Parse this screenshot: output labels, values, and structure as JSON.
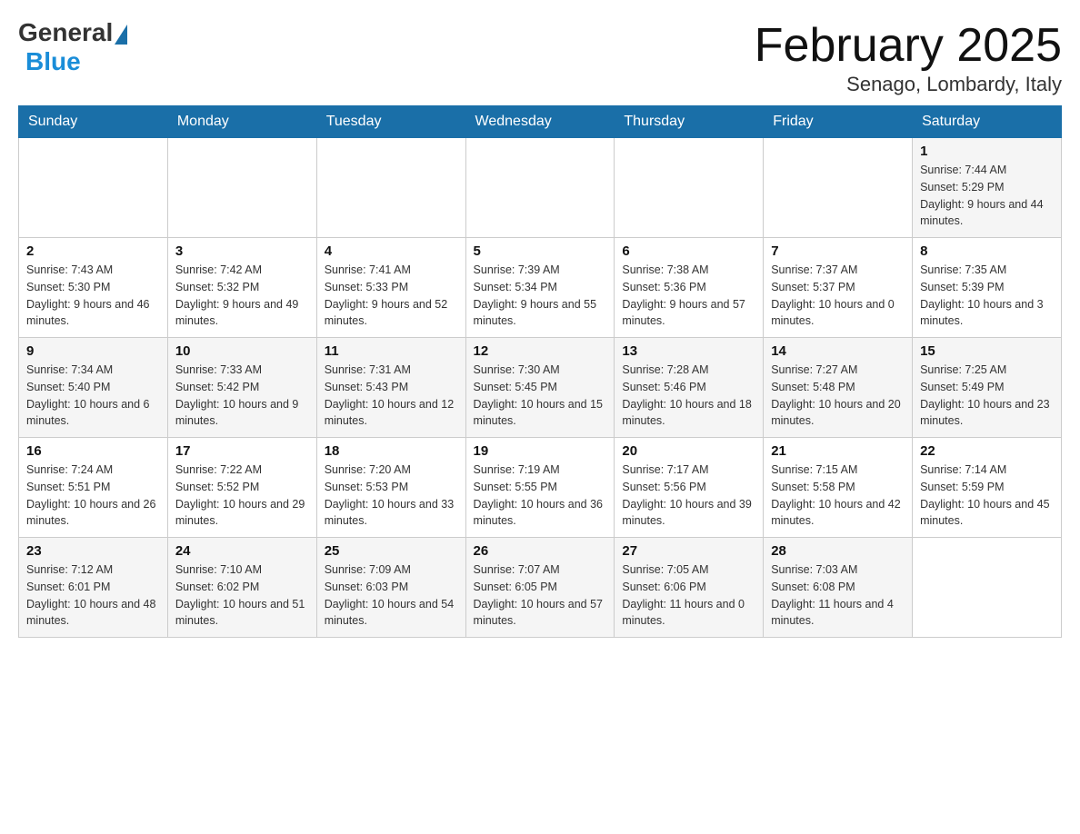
{
  "logo": {
    "general": "General",
    "blue": "Blue"
  },
  "title": "February 2025",
  "subtitle": "Senago, Lombardy, Italy",
  "days_header": [
    "Sunday",
    "Monday",
    "Tuesday",
    "Wednesday",
    "Thursday",
    "Friday",
    "Saturday"
  ],
  "weeks": [
    [
      {
        "day": "",
        "info": ""
      },
      {
        "day": "",
        "info": ""
      },
      {
        "day": "",
        "info": ""
      },
      {
        "day": "",
        "info": ""
      },
      {
        "day": "",
        "info": ""
      },
      {
        "day": "",
        "info": ""
      },
      {
        "day": "1",
        "info": "Sunrise: 7:44 AM\nSunset: 5:29 PM\nDaylight: 9 hours and 44 minutes."
      }
    ],
    [
      {
        "day": "2",
        "info": "Sunrise: 7:43 AM\nSunset: 5:30 PM\nDaylight: 9 hours and 46 minutes."
      },
      {
        "day": "3",
        "info": "Sunrise: 7:42 AM\nSunset: 5:32 PM\nDaylight: 9 hours and 49 minutes."
      },
      {
        "day": "4",
        "info": "Sunrise: 7:41 AM\nSunset: 5:33 PM\nDaylight: 9 hours and 52 minutes."
      },
      {
        "day": "5",
        "info": "Sunrise: 7:39 AM\nSunset: 5:34 PM\nDaylight: 9 hours and 55 minutes."
      },
      {
        "day": "6",
        "info": "Sunrise: 7:38 AM\nSunset: 5:36 PM\nDaylight: 9 hours and 57 minutes."
      },
      {
        "day": "7",
        "info": "Sunrise: 7:37 AM\nSunset: 5:37 PM\nDaylight: 10 hours and 0 minutes."
      },
      {
        "day": "8",
        "info": "Sunrise: 7:35 AM\nSunset: 5:39 PM\nDaylight: 10 hours and 3 minutes."
      }
    ],
    [
      {
        "day": "9",
        "info": "Sunrise: 7:34 AM\nSunset: 5:40 PM\nDaylight: 10 hours and 6 minutes."
      },
      {
        "day": "10",
        "info": "Sunrise: 7:33 AM\nSunset: 5:42 PM\nDaylight: 10 hours and 9 minutes."
      },
      {
        "day": "11",
        "info": "Sunrise: 7:31 AM\nSunset: 5:43 PM\nDaylight: 10 hours and 12 minutes."
      },
      {
        "day": "12",
        "info": "Sunrise: 7:30 AM\nSunset: 5:45 PM\nDaylight: 10 hours and 15 minutes."
      },
      {
        "day": "13",
        "info": "Sunrise: 7:28 AM\nSunset: 5:46 PM\nDaylight: 10 hours and 18 minutes."
      },
      {
        "day": "14",
        "info": "Sunrise: 7:27 AM\nSunset: 5:48 PM\nDaylight: 10 hours and 20 minutes."
      },
      {
        "day": "15",
        "info": "Sunrise: 7:25 AM\nSunset: 5:49 PM\nDaylight: 10 hours and 23 minutes."
      }
    ],
    [
      {
        "day": "16",
        "info": "Sunrise: 7:24 AM\nSunset: 5:51 PM\nDaylight: 10 hours and 26 minutes."
      },
      {
        "day": "17",
        "info": "Sunrise: 7:22 AM\nSunset: 5:52 PM\nDaylight: 10 hours and 29 minutes."
      },
      {
        "day": "18",
        "info": "Sunrise: 7:20 AM\nSunset: 5:53 PM\nDaylight: 10 hours and 33 minutes."
      },
      {
        "day": "19",
        "info": "Sunrise: 7:19 AM\nSunset: 5:55 PM\nDaylight: 10 hours and 36 minutes."
      },
      {
        "day": "20",
        "info": "Sunrise: 7:17 AM\nSunset: 5:56 PM\nDaylight: 10 hours and 39 minutes."
      },
      {
        "day": "21",
        "info": "Sunrise: 7:15 AM\nSunset: 5:58 PM\nDaylight: 10 hours and 42 minutes."
      },
      {
        "day": "22",
        "info": "Sunrise: 7:14 AM\nSunset: 5:59 PM\nDaylight: 10 hours and 45 minutes."
      }
    ],
    [
      {
        "day": "23",
        "info": "Sunrise: 7:12 AM\nSunset: 6:01 PM\nDaylight: 10 hours and 48 minutes."
      },
      {
        "day": "24",
        "info": "Sunrise: 7:10 AM\nSunset: 6:02 PM\nDaylight: 10 hours and 51 minutes."
      },
      {
        "day": "25",
        "info": "Sunrise: 7:09 AM\nSunset: 6:03 PM\nDaylight: 10 hours and 54 minutes."
      },
      {
        "day": "26",
        "info": "Sunrise: 7:07 AM\nSunset: 6:05 PM\nDaylight: 10 hours and 57 minutes."
      },
      {
        "day": "27",
        "info": "Sunrise: 7:05 AM\nSunset: 6:06 PM\nDaylight: 11 hours and 0 minutes."
      },
      {
        "day": "28",
        "info": "Sunrise: 7:03 AM\nSunset: 6:08 PM\nDaylight: 11 hours and 4 minutes."
      },
      {
        "day": "",
        "info": ""
      }
    ]
  ]
}
